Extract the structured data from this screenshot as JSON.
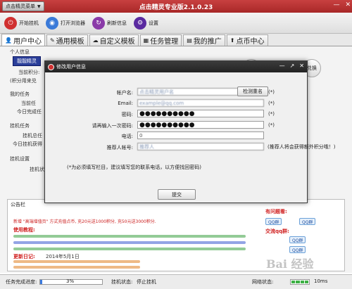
{
  "titlebar": {
    "menu_label": "点击精灵菜单",
    "title": "点击精灵专业版2.1.0.23",
    "min": "—",
    "close": "✕"
  },
  "toolbar": {
    "buttons": [
      {
        "label": "开始挂机",
        "color": "#d03030",
        "glyph": "⏻"
      },
      {
        "label": "打开浏览器",
        "color": "#3a7ad8",
        "glyph": "◉"
      },
      {
        "label": "刷新信息",
        "color": "#8a3aa8",
        "glyph": "↻"
      },
      {
        "label": "设置",
        "color": "#5a2aa0",
        "glyph": "⚙"
      }
    ]
  },
  "tabs": [
    {
      "label": "用户中心",
      "icon": "👤"
    },
    {
      "label": "通用模板",
      "icon": "✎"
    },
    {
      "label": "自定义模板",
      "icon": "☁"
    },
    {
      "label": "任务管理",
      "icon": "▦"
    },
    {
      "label": "我的推广",
      "icon": "▤"
    },
    {
      "label": "点币中心",
      "icon": "⬆"
    }
  ],
  "main": {
    "personal_info": "个人信息",
    "current_points": "当前积分:",
    "points_note": "(积分用来兑",
    "my_tasks": "我的任务",
    "current_task": "当前任",
    "today_done": "今日完成任",
    "hangup_tasks": "挂机任务",
    "hangup_total": "挂机总任",
    "today_hangup": "今日挂机获得",
    "hangup_settings": "挂机设置",
    "hangup_mode": "挂机状",
    "notice_title": "公告栏",
    "logo_text": "靓靓精灵",
    "side_btn_exchange": "兑换"
  },
  "notice": {
    "line1": "新增 \"高端增值页\" 方式充值点币, 充20元送1000积分, 充50元送3000积分.",
    "line2": "使用教程:",
    "right_title": "有问题看:",
    "qq_group": "QQ群",
    "right_sub": "交流qq群:",
    "date_label": "更新日记:",
    "date_value": "2014年5月1日"
  },
  "modal": {
    "title": "修改用户信息",
    "fields": [
      {
        "label": "帐户名:",
        "value": "点击精灵用户名",
        "type": "text",
        "blur": true
      },
      {
        "label": "Email:",
        "value": "example@qq.com",
        "type": "text",
        "blur": true
      },
      {
        "label": "密码:",
        "value": "●●●●●●●●●●",
        "type": "pw",
        "blur": false
      },
      {
        "label": "请再输入一次密码:",
        "value": "●●●●●●●●●●",
        "type": "pw",
        "blur": false
      },
      {
        "label": "电话:",
        "value": "0",
        "type": "text",
        "blur": false
      },
      {
        "label": "推荐人帐号:",
        "value": "推荐人",
        "type": "text",
        "blur": true
      }
    ],
    "star": "(*)",
    "check_dup": "检测重名",
    "referrer_hint": "(推荐人将会获得额外积分哦！)",
    "required_note": "(*为必须填写栏目，建议填写您的联系电话，以方便找回密码)",
    "submit": "提交"
  },
  "status": {
    "progress_label": "任务完成进度:",
    "progress_pct": "3%",
    "progress_value": 3,
    "hangup_status_label": "挂机状态:",
    "hangup_status": "停止挂机",
    "net_label": "网络状态:",
    "latency": "10ms"
  },
  "watermark": "Bai 经验"
}
